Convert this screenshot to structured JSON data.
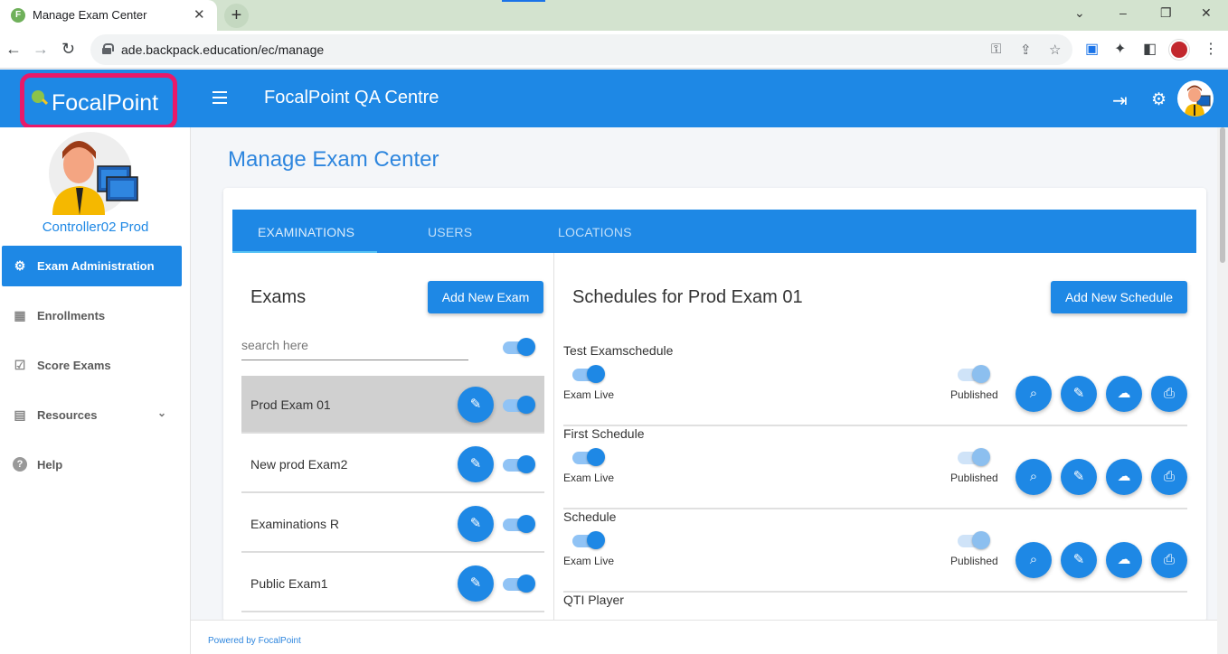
{
  "browser": {
    "tab_title": "Manage Exam Center",
    "tab_close": "✕",
    "new_tab": "+",
    "url": "ade.backpack.education/ec/manage",
    "controls": {
      "minimize": "–",
      "maximize": "❐",
      "close": "✕"
    }
  },
  "app": {
    "brand": "FocalPoint",
    "title": "FocalPoint QA Centre"
  },
  "sidebar": {
    "user_name": "Controller02 Prod",
    "items": [
      {
        "label": "Exam Administration",
        "icon": "gear-icon",
        "glyph": "⚙"
      },
      {
        "label": "Enrollments",
        "icon": "bar-chart-icon",
        "glyph": "▦"
      },
      {
        "label": "Score Exams",
        "icon": "score-icon",
        "glyph": "☑"
      },
      {
        "label": "Resources",
        "icon": "resources-icon",
        "glyph": "▤",
        "chevron": "⌄"
      },
      {
        "label": "Help",
        "icon": "help-icon",
        "glyph": "?"
      }
    ]
  },
  "page": {
    "heading": "Manage Exam Center",
    "tabs": [
      "EXAMINATIONS",
      "USERS",
      "LOCATIONS"
    ]
  },
  "exams": {
    "title": "Exams",
    "add_label": "Add New Exam",
    "search_placeholder": "search here",
    "list": [
      {
        "name": "Prod Exam 01"
      },
      {
        "name": "New prod Exam2"
      },
      {
        "name": "Examinations R"
      },
      {
        "name": "Public Exam1"
      }
    ]
  },
  "schedules": {
    "title": "Schedules for Prod Exam 01",
    "add_label": "Add New Schedule",
    "live_label": "Exam Live",
    "published_label": "Published",
    "list": [
      {
        "name": "Test Examschedule"
      },
      {
        "name": "First Schedule"
      },
      {
        "name": "Schedule"
      },
      {
        "name": "QTI Player"
      }
    ]
  },
  "footer": {
    "text": "Powered by FocalPoint"
  },
  "colors": {
    "primary": "#1e88e5",
    "brand_highlight": "#e8196a",
    "heading": "#2e86de"
  }
}
